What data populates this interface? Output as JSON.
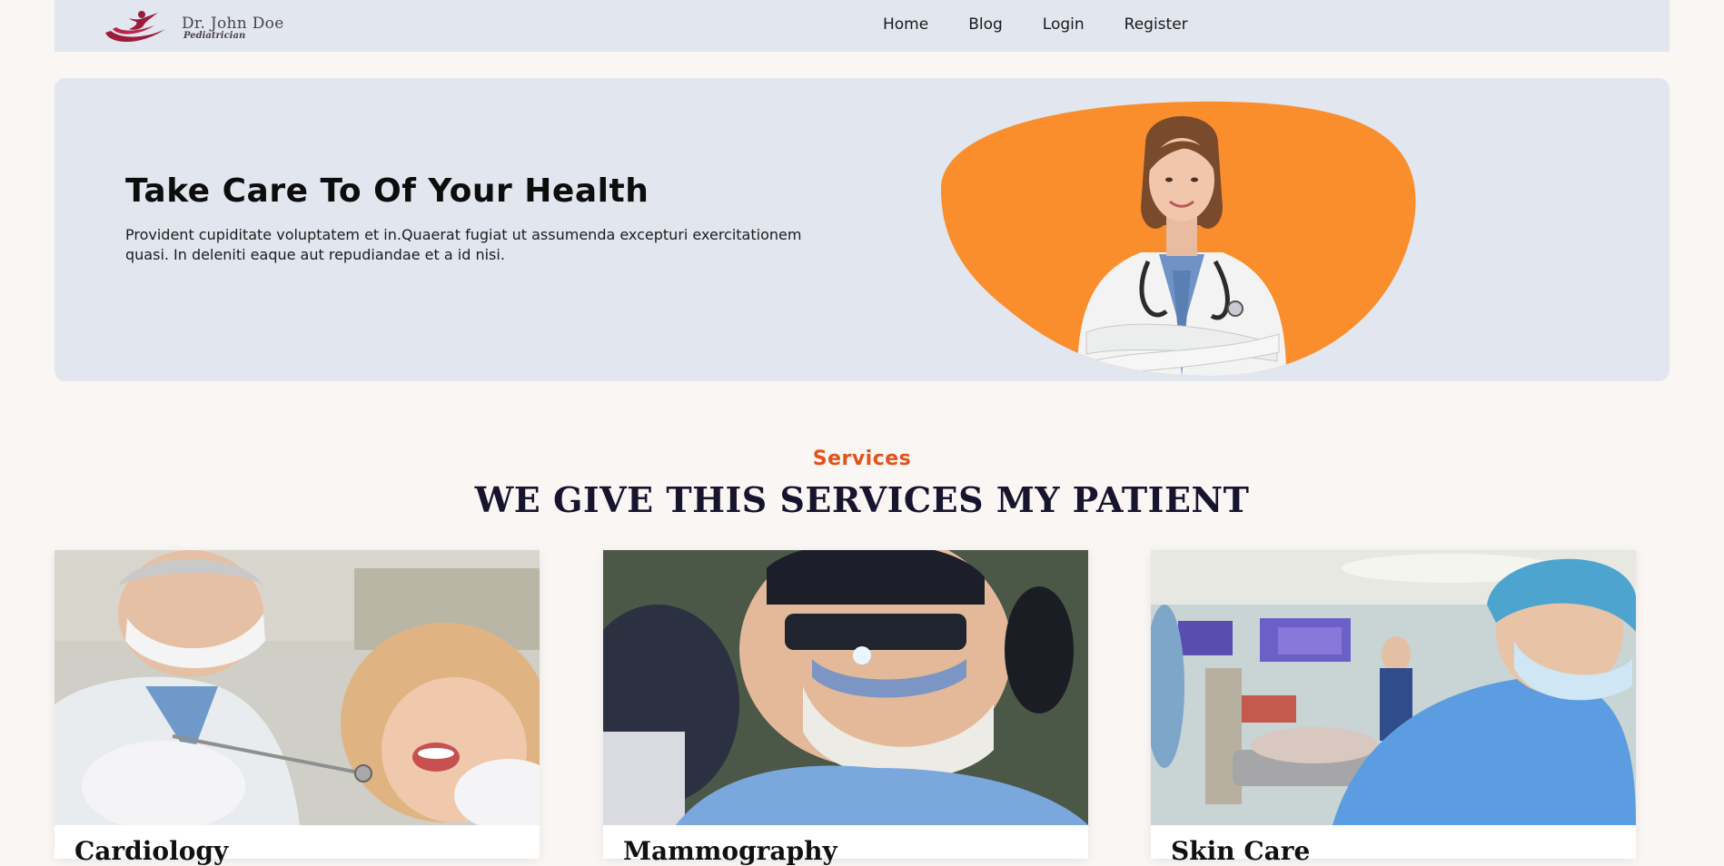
{
  "brand": {
    "name": "Dr. John Doe",
    "subtitle": "Pediatrician",
    "logo_icon": "figure-swirl-logo"
  },
  "nav": {
    "items": [
      {
        "label": "Home"
      },
      {
        "label": "Blog"
      },
      {
        "label": "Login"
      },
      {
        "label": "Register"
      }
    ]
  },
  "hero": {
    "title": "Take Care To Of Your Health",
    "text": "Provident cupiditate voluptatem et in.Quaerat fugiat ut assumenda excepturi exercitationem quasi. In deleniti eaque aut repudiandae et a id nisi.",
    "image": "doctor-portrait"
  },
  "services": {
    "label": "Services",
    "title": "WE GIVE THIS SERVICES MY PATIENT",
    "cards": [
      {
        "title": "Cardiology",
        "image": "dentist-with-patient-photo"
      },
      {
        "title": "Mammography",
        "image": "surgeon-with-headlamp-photo"
      },
      {
        "title": "Skin Care",
        "image": "operating-room-photo"
      }
    ]
  },
  "colors": {
    "nav_bg": "#e1e6ef",
    "hero_bg": "#e1e6ef",
    "page_bg": "#f9f6f4",
    "accent": "#e2531b",
    "blob": "#fa8d2c",
    "logo": "#9b1b3a"
  }
}
